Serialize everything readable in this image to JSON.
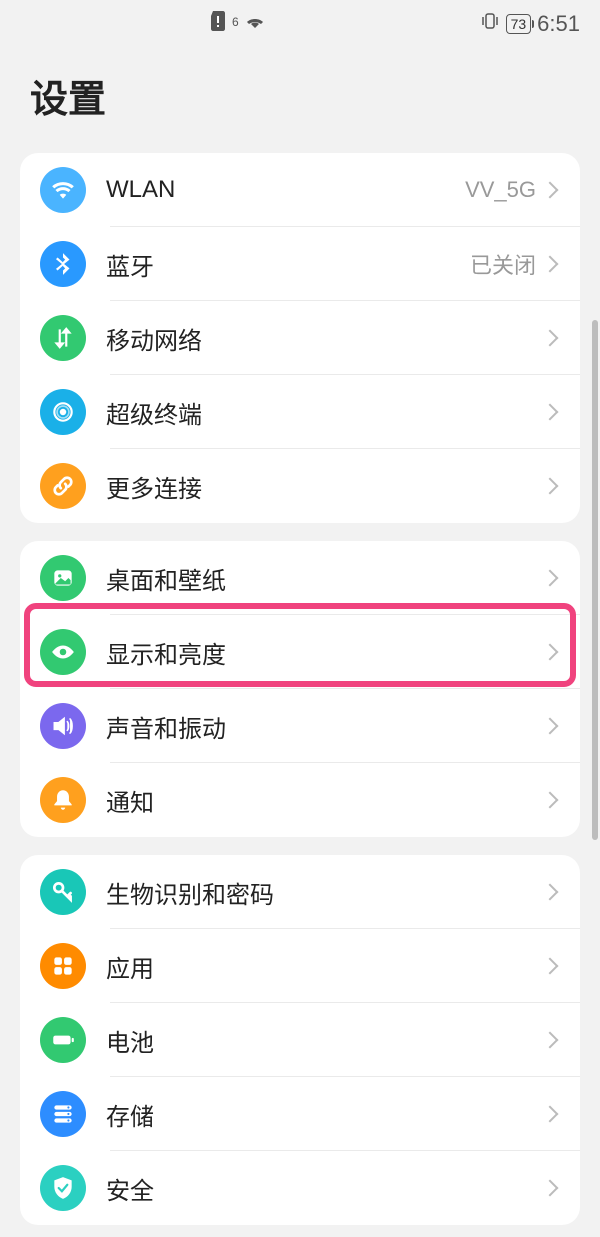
{
  "statusbar": {
    "battery": "73",
    "time": "6:51"
  },
  "header": {
    "title": "设置"
  },
  "sections": [
    {
      "rows": [
        {
          "label": "WLAN",
          "value": "VV_5G"
        },
        {
          "label": "蓝牙",
          "value": "已关闭"
        },
        {
          "label": "移动网络",
          "value": ""
        },
        {
          "label": "超级终端",
          "value": ""
        },
        {
          "label": "更多连接",
          "value": ""
        }
      ]
    },
    {
      "rows": [
        {
          "label": "桌面和壁纸",
          "value": ""
        },
        {
          "label": "显示和亮度",
          "value": ""
        },
        {
          "label": "声音和振动",
          "value": ""
        },
        {
          "label": "通知",
          "value": ""
        }
      ]
    },
    {
      "rows": [
        {
          "label": "生物识别和密码",
          "value": ""
        },
        {
          "label": "应用",
          "value": ""
        },
        {
          "label": "电池",
          "value": ""
        },
        {
          "label": "存储",
          "value": ""
        },
        {
          "label": "安全",
          "value": ""
        }
      ]
    }
  ]
}
